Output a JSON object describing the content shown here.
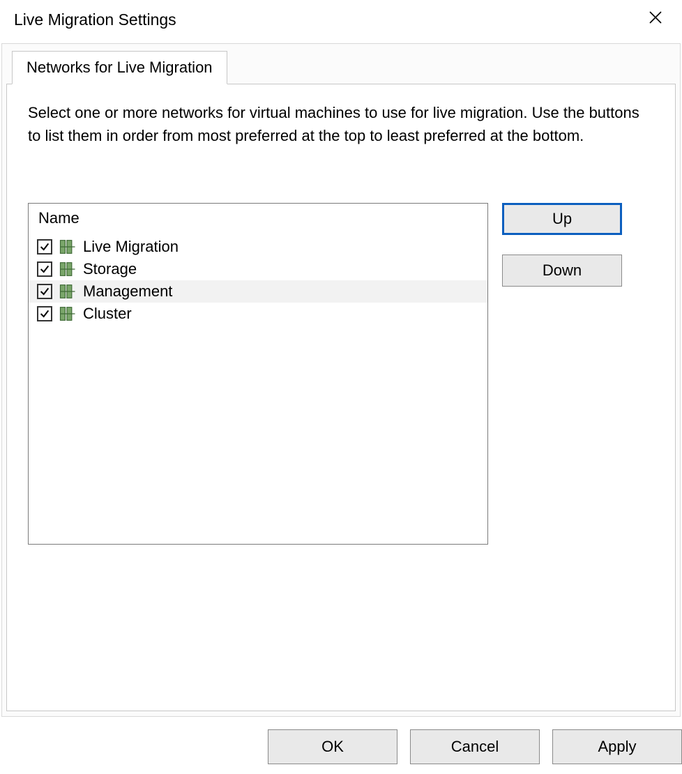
{
  "window": {
    "title": "Live Migration Settings"
  },
  "tabs": {
    "networks": "Networks for Live Migration"
  },
  "panel": {
    "description": "Select one or more networks for virtual machines to use for live migration. Use the buttons to list them in order from most preferred at the top to least preferred at the bottom.",
    "list_header": "Name",
    "networks": [
      {
        "label": "Live Migration",
        "checked": true,
        "selected": false
      },
      {
        "label": "Storage",
        "checked": true,
        "selected": false
      },
      {
        "label": "Management",
        "checked": true,
        "selected": true
      },
      {
        "label": "Cluster",
        "checked": true,
        "selected": false
      }
    ]
  },
  "buttons": {
    "up": "Up",
    "down": "Down",
    "ok": "OK",
    "cancel": "Cancel",
    "apply": "Apply"
  }
}
